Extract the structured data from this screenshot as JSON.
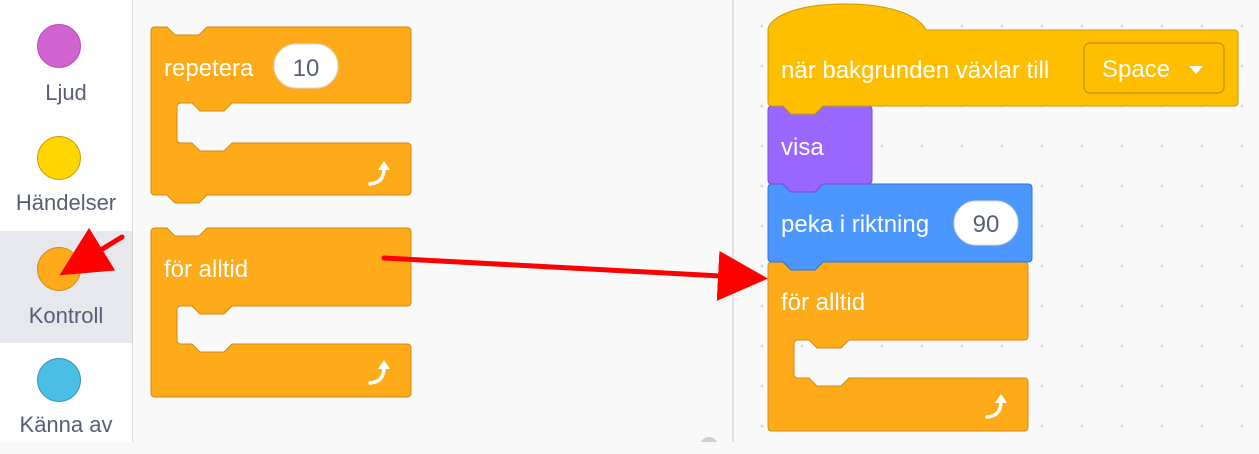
{
  "sidebar": {
    "categories": [
      {
        "label": "Ljud",
        "color": "#cf63cf",
        "border": "#bd42bd"
      },
      {
        "label": "Händelser",
        "color": "#ffd500",
        "border": "#cc9900"
      },
      {
        "label": "Kontroll",
        "color": "#ffab19",
        "border": "#cf8b17",
        "selected": true
      },
      {
        "label": "Känna av",
        "color": "#4cbfe6",
        "border": "#2e8eb8"
      }
    ]
  },
  "palette": {
    "repeat_block": {
      "label": "repetera",
      "count": "10"
    },
    "forever_block": {
      "label": "för alltid"
    }
  },
  "script": {
    "hat_block": {
      "label": "när bakgrunden växlar till",
      "dropdown_value": "Space"
    },
    "show_block": {
      "label": "visa"
    },
    "point_block": {
      "label": "peka i riktning",
      "direction": "90"
    },
    "forever_block": {
      "label": "för alltid"
    }
  },
  "colors": {
    "control": "#ffab19",
    "events": "#ffbf00",
    "looks": "#9966ff",
    "motion": "#4c97ff",
    "annotation_arrow": "#ff0000"
  }
}
